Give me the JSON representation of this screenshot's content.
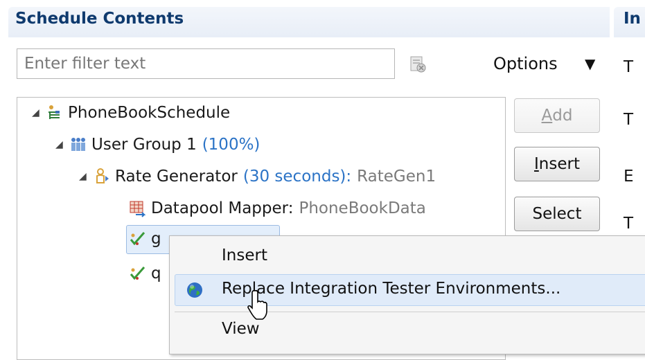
{
  "panel": {
    "title": "Schedule Contents",
    "right_title_partial": "In"
  },
  "filter": {
    "placeholder": "Enter filter text",
    "value": ""
  },
  "options": {
    "label": "Options"
  },
  "tree": {
    "root": {
      "label": "PhoneBookSchedule"
    },
    "user_group": {
      "label": "User Group 1",
      "percent": "(100%)"
    },
    "rate_generator": {
      "label": "Rate Generator",
      "interval": "(30 seconds):",
      "name": "RateGen1"
    },
    "datapool_mapper": {
      "label": "Datapool Mapper:",
      "data": "PhoneBookData"
    },
    "test1": {
      "label_partial": "g"
    },
    "test2": {
      "label_partial": "q"
    }
  },
  "buttons": {
    "add": {
      "label": "Add",
      "mnemonic": "A",
      "rest": "dd",
      "enabled": false
    },
    "insert": {
      "label": "Insert",
      "mnemonic": "I",
      "rest": "nsert"
    },
    "select": {
      "label": "Select"
    }
  },
  "right_labels": [
    "T",
    "T",
    "E",
    "T"
  ],
  "context_menu": {
    "items": [
      {
        "label": "Insert"
      },
      {
        "label": "Replace Integration Tester Environments...",
        "icon": "globe-icon",
        "highlighted": true
      },
      {
        "label": "View"
      }
    ]
  },
  "colors": {
    "header_text": "#0f3a6e",
    "accent_blue": "#2b73c6",
    "secondary_gray": "#7a7a7a",
    "menu_highlight": "#e0ebf9"
  }
}
